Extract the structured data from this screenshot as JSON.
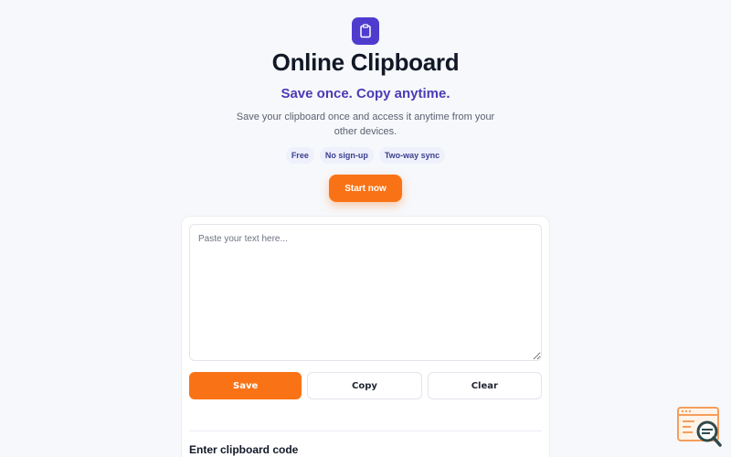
{
  "header": {
    "logo_icon": "clipboard-icon",
    "title": "Online Clipboard",
    "tagline": "Save once. Copy anytime.",
    "subtitle": "Save your clipboard once and access it anytime from your other devices.",
    "badges": [
      "Free",
      "No sign-up",
      "Two-way sync"
    ],
    "start_label": "Start now"
  },
  "editor": {
    "placeholder": "Paste your text here...",
    "value": "",
    "save_label": "Save",
    "copy_label": "Copy",
    "clear_label": "Clear"
  },
  "code_section": {
    "heading": "Enter clipboard code"
  },
  "widget": {
    "icon": "search-browser-icon"
  },
  "colors": {
    "accent": "#f97316",
    "brand": "#4f3ccf",
    "tagline": "#4a3bb5"
  }
}
